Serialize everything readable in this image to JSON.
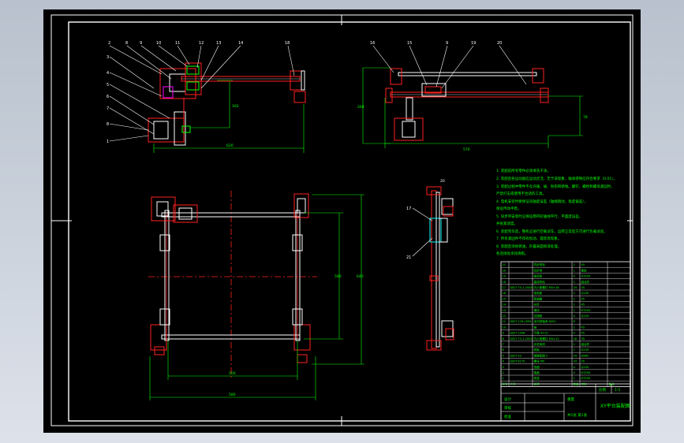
{
  "drawing": {
    "background": "#000000",
    "frame_color": "#ffffff",
    "dimension_color": "#00ff00",
    "outline_color": "#ff2020"
  },
  "balloons_top_left": [
    "2",
    "8",
    "9",
    "10",
    "11",
    "12",
    "13",
    "14",
    "18"
  ],
  "balloons_left_column": [
    "3",
    "4",
    "5",
    "6",
    "7",
    "8",
    "1"
  ],
  "balloons_top_right": [
    "16",
    "15",
    "9",
    "19",
    "20"
  ],
  "balloons_side": [
    "17",
    "21"
  ],
  "dimensions": {
    "top_left_width": "620",
    "top_left_height": "162",
    "top_right_width": "570",
    "top_right_height_left": "268",
    "top_right_height_right": "78",
    "plan_inner_width": "500",
    "plan_outer_width": "580",
    "plan_inner_height": "500",
    "plan_outer_height": "640",
    "side_top": "20"
  },
  "notes": [
    "1. 装配前所有零件必须清洗干净。",
    "2. 装配后各运动副应运动灵活，无卡滞现象，轴承游隙应符合要求（0.01）。",
    "3. 装配过程中零件不允许磕、碰、划伤和锈蚀。螺钉、螺栓和螺母紧固时，",
    "   严禁打击或使用不合适的工具。",
    "4. 电机安装时要保证同轴度误差（轴端跳动，角度偏差），",
    "   保证传动平稳。",
    "5. 同步带安装时应保证两带轮轴线平行，平面度误差，",
    "   并张紧适度。",
    "6. 装配完毕后，整机应进行空载试车，运转正常后方可进行负载试验。",
    "7. 所有紧固件不得有松动、漏装等现象。",
    "8. 装配后涂防锈油，外露表面喷漆处理。",
    "   各连接处涂润滑脂。"
  ],
  "bom_rows": [
    [
      "21",
      "",
      "同步带轮",
      "2",
      "45",
      ""
    ],
    [
      "20",
      "",
      "同步带",
      "1",
      "橡胶",
      ""
    ],
    [
      "19",
      "",
      "轴承座",
      "4",
      "HT200",
      ""
    ],
    [
      "18",
      "",
      "直线导轨",
      "2",
      "组合件",
      ""
    ],
    [
      "17",
      "GB/T 70.1-2000",
      "内六角螺钉 M5×16",
      "24",
      "35",
      ""
    ],
    [
      "16",
      "",
      "电机座",
      "2",
      "Q235",
      ""
    ],
    [
      "15",
      "",
      "联轴器",
      "2",
      "45",
      ""
    ],
    [
      "14",
      "",
      "光杠",
      "2",
      "45",
      ""
    ],
    [
      "13",
      "",
      "滑块",
      "2",
      "HT200",
      ""
    ],
    [
      "12",
      "",
      "支撑座",
      "4",
      "Q235",
      ""
    ],
    [
      "11",
      "GB/T 276-1994",
      "深沟球轴承 6201",
      "8",
      "",
      ""
    ],
    [
      "10",
      "",
      "轴",
      "2",
      "45",
      ""
    ],
    [
      "9",
      "GB/T 1096",
      "平键 4×10",
      "4",
      "45",
      ""
    ],
    [
      "8",
      "GB/T 70.1-2000",
      "内六角螺钉 M4×12",
      "16",
      "35",
      ""
    ],
    [
      "7",
      "",
      "步进电机",
      "2",
      "组合件",
      ""
    ],
    [
      "6",
      "",
      "底板",
      "1",
      "Q235",
      ""
    ],
    [
      "5",
      "GB/T 93",
      "弹簧垫圈 5",
      "24",
      "65Mn",
      ""
    ],
    [
      "4",
      "GB/T 6170",
      "螺母 M5",
      "24",
      "35",
      ""
    ],
    [
      "3",
      "",
      "挡圈",
      "4",
      "Q235",
      ""
    ],
    [
      "2",
      "",
      "端盖",
      "4",
      "HT200",
      ""
    ],
    [
      "1",
      "",
      "底座",
      "1",
      "HT200",
      ""
    ]
  ],
  "bom_header": [
    "序号",
    "代号",
    "名称",
    "数量",
    "材料",
    "备注"
  ],
  "title_block": {
    "title": "XY平台装配图",
    "scale_label": "比例",
    "scale": "1:5",
    "sheet": "共1张 第1张",
    "designer": "设计",
    "checker": "审核",
    "approver": "批准",
    "weight_label": "重量"
  }
}
